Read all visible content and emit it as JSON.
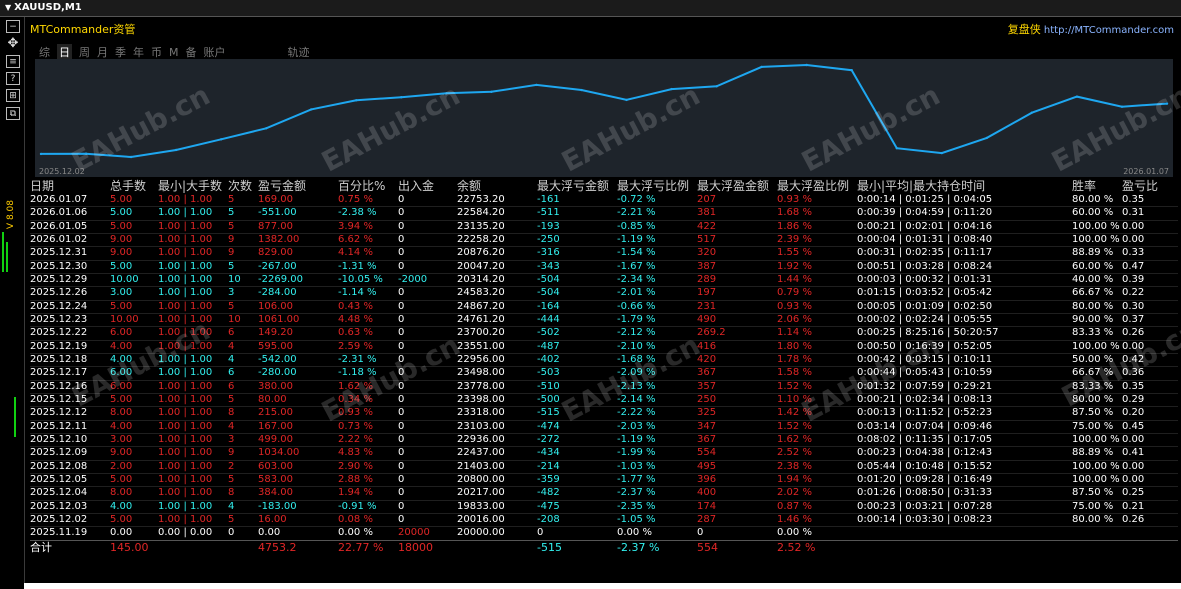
{
  "window": {
    "title": "XAUUSD,M1"
  },
  "side": {
    "version_label": "V 8.08"
  },
  "app": {
    "name": "MTCommander资管",
    "right_cn": "复盘侠",
    "right_url": "http://MTCommander.com"
  },
  "tabs": [
    {
      "label": "综",
      "active": false
    },
    {
      "label": "日",
      "active": true
    },
    {
      "label": "周",
      "active": false
    },
    {
      "label": "月",
      "active": false
    },
    {
      "label": "季",
      "active": false
    },
    {
      "label": "年",
      "active": false
    },
    {
      "label": "币",
      "active": false
    },
    {
      "label": "M",
      "active": false
    },
    {
      "label": "备",
      "active": false
    },
    {
      "label": "账户",
      "active": false
    },
    {
      "label": "轨迹",
      "active": false
    }
  ],
  "chart_data": {
    "type": "line",
    "x_start_label": "2025.12.02",
    "x_end_label": "2026.01.07",
    "color": "#1ea7f0",
    "grid": false,
    "x": [
      "2025.11.19",
      "2025.12.02",
      "2025.12.03",
      "2025.12.04",
      "2025.12.05",
      "2025.12.08",
      "2025.12.09",
      "2025.12.10",
      "2025.12.11",
      "2025.12.12",
      "2025.12.15",
      "2025.12.16",
      "2025.12.17",
      "2025.12.18",
      "2025.12.19",
      "2025.12.22",
      "2025.12.23",
      "2025.12.24",
      "2025.12.26",
      "2025.12.29",
      "2025.12.30",
      "2025.12.31",
      "2026.01.02",
      "2026.01.05",
      "2026.01.06",
      "2026.01.07"
    ],
    "values": [
      20000.0,
      20016.0,
      19833.0,
      20217.0,
      20800.0,
      21403.0,
      22437.0,
      22936.0,
      23103.0,
      23318.0,
      23398.0,
      23778.0,
      23498.0,
      22956.0,
      23551.0,
      23700.0,
      24761.0,
      24867.0,
      24583.0,
      20314.2,
      20047.2,
      20876.2,
      22258.2,
      23135.2,
      22584.2,
      22753.2
    ]
  },
  "table": {
    "headers": [
      "日期",
      "总手数",
      "最小|大手数",
      "次数",
      "盈亏金额",
      "百分比%",
      "出入金",
      "余额",
      "最大浮亏金额",
      "最大浮亏比例",
      "最大浮盈金额",
      "最大浮盈比例",
      "最小|平均|最大持仓时间",
      "胜率",
      "盈亏比"
    ],
    "rows": [
      {
        "tone": "r",
        "cells": [
          "2026.01.07",
          "5.00",
          "1.00 | 1.00",
          "5",
          "169.00",
          "0.75 %",
          "0",
          "22753.20",
          "-161",
          "-0.72 %",
          "207",
          "0.93 %",
          "0:00:14 | 0:01:25 | 0:04:05",
          "80.00 %",
          "0.35"
        ]
      },
      {
        "tone": "c",
        "cells": [
          "2026.01.06",
          "5.00",
          "1.00 | 1.00",
          "5",
          "-551.00",
          "-2.38 %",
          "0",
          "22584.20",
          "-511",
          "-2.21 %",
          "381",
          "1.68 %",
          "0:00:39 | 0:04:59 | 0:11:20",
          "60.00 %",
          "0.31"
        ]
      },
      {
        "tone": "r",
        "cells": [
          "2026.01.05",
          "5.00",
          "1.00 | 1.00",
          "5",
          "877.00",
          "3.94 %",
          "0",
          "23135.20",
          "-193",
          "-0.85 %",
          "422",
          "1.86 %",
          "0:00:21 | 0:02:01 | 0:04:16",
          "100.00 %",
          "0.00"
        ]
      },
      {
        "tone": "r",
        "cells": [
          "2026.01.02",
          "9.00",
          "1.00 | 1.00",
          "9",
          "1382.00",
          "6.62 %",
          "0",
          "22258.20",
          "-250",
          "-1.19 %",
          "517",
          "2.39 %",
          "0:00:04 | 0:01:31 | 0:08:40",
          "100.00 %",
          "0.00"
        ]
      },
      {
        "tone": "r",
        "cells": [
          "2025.12.31",
          "9.00",
          "1.00 | 1.00",
          "9",
          "829.00",
          "4.14 %",
          "0",
          "20876.20",
          "-316",
          "-1.54 %",
          "320",
          "1.55 %",
          "0:00:31 | 0:02:35 | 0:11:17",
          "88.89 %",
          "0.33"
        ]
      },
      {
        "tone": "c",
        "cells": [
          "2025.12.30",
          "5.00",
          "1.00 | 1.00",
          "5",
          "-267.00",
          "-1.31 %",
          "0",
          "20047.20",
          "-343",
          "-1.67 %",
          "387",
          "1.92 %",
          "0:00:51 | 0:03:28 | 0:08:24",
          "60.00 %",
          "0.47"
        ]
      },
      {
        "tone": "c",
        "cells": [
          "2025.12.29",
          "10.00",
          "1.00 | 1.00",
          "10",
          "-2269.00",
          "-10.05 %",
          "-2000",
          "20314.20",
          "-504",
          "-2.34 %",
          "289",
          "1.44 %",
          "0:00:03 | 0:00:32 | 0:01:31",
          "40.00 %",
          "0.39"
        ]
      },
      {
        "tone": "c",
        "cells": [
          "2025.12.26",
          "3.00",
          "1.00 | 1.00",
          "3",
          "-284.00",
          "-1.14 %",
          "0",
          "24583.20",
          "-504",
          "-2.01 %",
          "197",
          "0.79 %",
          "0:01:15 | 0:03:52 | 0:05:42",
          "66.67 %",
          "0.22"
        ]
      },
      {
        "tone": "r",
        "cells": [
          "2025.12.24",
          "5.00",
          "1.00 | 1.00",
          "5",
          "106.00",
          "0.43 %",
          "0",
          "24867.20",
          "-164",
          "-0.66 %",
          "231",
          "0.93 %",
          "0:00:05 | 0:01:09 | 0:02:50",
          "80.00 %",
          "0.30"
        ]
      },
      {
        "tone": "r",
        "cells": [
          "2025.12.23",
          "10.00",
          "1.00 | 1.00",
          "10",
          "1061.00",
          "4.48 %",
          "0",
          "24761.20",
          "-444",
          "-1.79 %",
          "490",
          "2.06 %",
          "0:00:02 | 0:02:24 | 0:05:55",
          "90.00 %",
          "0.37"
        ]
      },
      {
        "tone": "r",
        "cells": [
          "2025.12.22",
          "6.00",
          "1.00 | 1.00",
          "6",
          "149.20",
          "0.63 %",
          "0",
          "23700.20",
          "-502",
          "-2.12 %",
          "269.2",
          "1.14 %",
          "0:00:25 | 8:25:16 | 50:20:57",
          "83.33 %",
          "0.26"
        ]
      },
      {
        "tone": "r",
        "cells": [
          "2025.12.19",
          "4.00",
          "1.00 | 1.00",
          "4",
          "595.00",
          "2.59 %",
          "0",
          "23551.00",
          "-487",
          "-2.10 %",
          "416",
          "1.80 %",
          "0:00:50 | 0:16:39 | 0:52:05",
          "100.00 %",
          "0.00"
        ]
      },
      {
        "tone": "c",
        "cells": [
          "2025.12.18",
          "4.00",
          "1.00 | 1.00",
          "4",
          "-542.00",
          "-2.31 %",
          "0",
          "22956.00",
          "-402",
          "-1.68 %",
          "420",
          "1.78 %",
          "0:00:42 | 0:03:15 | 0:10:11",
          "50.00 %",
          "0.42"
        ]
      },
      {
        "tone": "c",
        "cells": [
          "2025.12.17",
          "6.00",
          "1.00 | 1.00",
          "6",
          "-280.00",
          "-1.18 %",
          "0",
          "23498.00",
          "-503",
          "-2.09 %",
          "367",
          "1.58 %",
          "0:00:44 | 0:05:43 | 0:10:59",
          "66.67 %",
          "0.36"
        ]
      },
      {
        "tone": "r",
        "cells": [
          "2025.12.16",
          "6.00",
          "1.00 | 1.00",
          "6",
          "380.00",
          "1.62 %",
          "0",
          "23778.00",
          "-510",
          "-2.13 %",
          "357",
          "1.52 %",
          "0:01:32 | 0:07:59 | 0:29:21",
          "83.33 %",
          "0.35"
        ]
      },
      {
        "tone": "r",
        "cells": [
          "2025.12.15",
          "5.00",
          "1.00 | 1.00",
          "5",
          "80.00",
          "0.34 %",
          "0",
          "23398.00",
          "-500",
          "-2.14 %",
          "250",
          "1.10 %",
          "0:00:21 | 0:02:34 | 0:08:13",
          "80.00 %",
          "0.29"
        ]
      },
      {
        "tone": "r",
        "cells": [
          "2025.12.12",
          "8.00",
          "1.00 | 1.00",
          "8",
          "215.00",
          "0.93 %",
          "0",
          "23318.00",
          "-515",
          "-2.22 %",
          "325",
          "1.42 %",
          "0:00:13 | 0:11:52 | 0:52:23",
          "87.50 %",
          "0.20"
        ]
      },
      {
        "tone": "r",
        "cells": [
          "2025.12.11",
          "4.00",
          "1.00 | 1.00",
          "4",
          "167.00",
          "0.73 %",
          "0",
          "23103.00",
          "-474",
          "-2.03 %",
          "347",
          "1.52 %",
          "0:03:14 | 0:07:04 | 0:09:46",
          "75.00 %",
          "0.45"
        ]
      },
      {
        "tone": "r",
        "cells": [
          "2025.12.10",
          "3.00",
          "1.00 | 1.00",
          "3",
          "499.00",
          "2.22 %",
          "0",
          "22936.00",
          "-272",
          "-1.19 %",
          "367",
          "1.62 %",
          "0:08:02 | 0:11:35 | 0:17:05",
          "100.00 %",
          "0.00"
        ]
      },
      {
        "tone": "r",
        "cells": [
          "2025.12.09",
          "9.00",
          "1.00 | 1.00",
          "9",
          "1034.00",
          "4.83 %",
          "0",
          "22437.00",
          "-434",
          "-1.99 %",
          "554",
          "2.52 %",
          "0:00:23 | 0:04:38 | 0:12:43",
          "88.89 %",
          "0.41"
        ]
      },
      {
        "tone": "r",
        "cells": [
          "2025.12.08",
          "2.00",
          "1.00 | 1.00",
          "2",
          "603.00",
          "2.90 %",
          "0",
          "21403.00",
          "-214",
          "-1.03 %",
          "495",
          "2.38 %",
          "0:05:44 | 0:10:48 | 0:15:52",
          "100.00 %",
          "0.00"
        ]
      },
      {
        "tone": "r",
        "cells": [
          "2025.12.05",
          "5.00",
          "1.00 | 1.00",
          "5",
          "583.00",
          "2.88 %",
          "0",
          "20800.00",
          "-359",
          "-1.77 %",
          "396",
          "1.94 %",
          "0:01:20 | 0:09:28 | 0:16:49",
          "100.00 %",
          "0.00"
        ]
      },
      {
        "tone": "r",
        "cells": [
          "2025.12.04",
          "8.00",
          "1.00 | 1.00",
          "8",
          "384.00",
          "1.94 %",
          "0",
          "20217.00",
          "-482",
          "-2.37 %",
          "400",
          "2.02 %",
          "0:01:26 | 0:08:50 | 0:31:33",
          "87.50 %",
          "0.25"
        ]
      },
      {
        "tone": "c",
        "cells": [
          "2025.12.03",
          "4.00",
          "1.00 | 1.00",
          "4",
          "-183.00",
          "-0.91 %",
          "0",
          "19833.00",
          "-475",
          "-2.35 %",
          "174",
          "0.87 %",
          "0:00:23 | 0:03:21 | 0:07:28",
          "75.00 %",
          "0.21"
        ]
      },
      {
        "tone": "r",
        "cells": [
          "2025.12.02",
          "5.00",
          "1.00 | 1.00",
          "5",
          "16.00",
          "0.08 %",
          "0",
          "20016.00",
          "-208",
          "-1.05 %",
          "287",
          "1.46 %",
          "0:00:14 | 0:03:30 | 0:08:23",
          "80.00 %",
          "0.26"
        ]
      },
      {
        "tone": "w",
        "cells": [
          "2025.11.19",
          "0.00",
          "0.00 | 0.00",
          "0",
          "0.00",
          "0.00 %",
          "20000",
          "20000.00",
          "0",
          "0.00 %",
          "0",
          "0.00 %",
          "",
          "",
          ""
        ]
      }
    ],
    "total": {
      "label": "合计",
      "lots": "145.00",
      "pnl": "4753.2",
      "pct": "22.77 %",
      "io": "18000",
      "max_float_loss": "-515",
      "max_float_loss_pct": "-2.37 %",
      "max_float_profit": "554",
      "max_float_profit_pct": "2.52 %"
    }
  },
  "watermark": "EAHub.cn"
}
